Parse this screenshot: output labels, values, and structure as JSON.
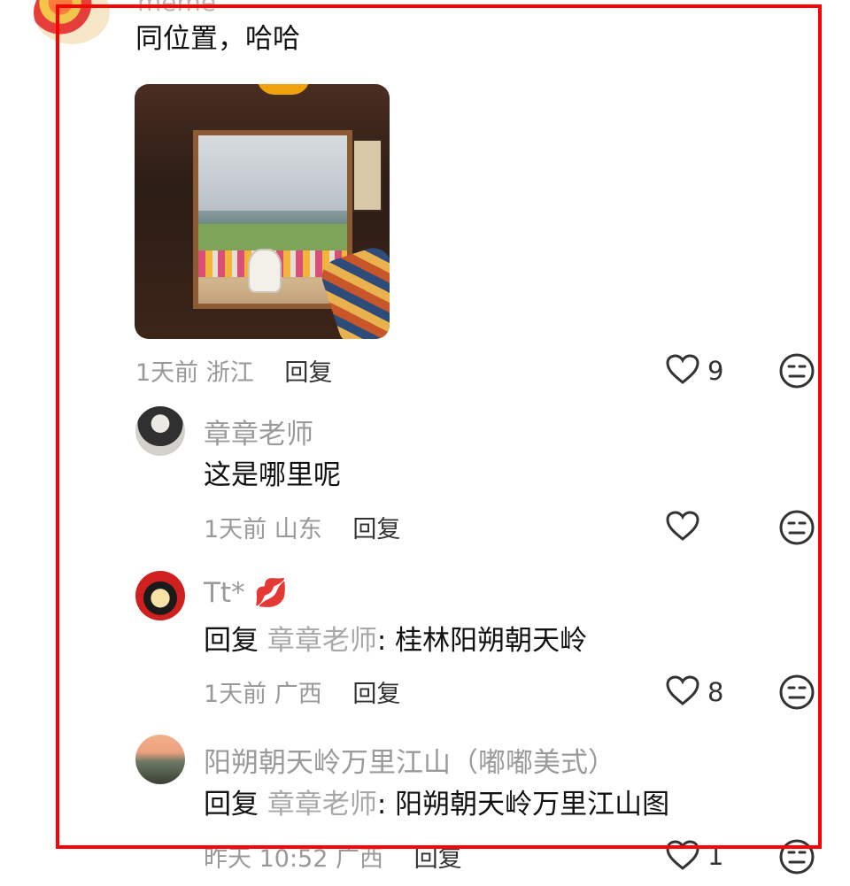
{
  "top": {
    "name": "meme",
    "comment": "同位置，哈哈",
    "time_location": "1天前 浙江",
    "reply_label": "回复",
    "like_count": "9"
  },
  "replies": [
    {
      "name": "章章老师",
      "text": "这是哪里呢",
      "time_location": "1天前 山东",
      "reply_label": "回复",
      "like_count": ""
    },
    {
      "name": "Tt*",
      "name_emoji": "💋",
      "prefix": "回复",
      "target": "章章老师",
      "text": ": 桂林阳朔朝天岭",
      "time_location": "1天前 广西",
      "reply_label": "回复",
      "like_count": "8"
    },
    {
      "name": "阳朔朝天岭万里江山（嘟嘟美式）",
      "prefix": "回复",
      "target": "章章老师",
      "text": ": 阳朔朝天岭万里江山图",
      "time_location": "昨天 10:52 广西",
      "reply_label": "回复",
      "like_count": "1"
    }
  ],
  "icons": {
    "like": "heart-outline-icon",
    "emoji": "neutral-face-icon"
  },
  "colors": {
    "highlight": "#ff0000",
    "muted": "#999999",
    "text": "#111111"
  }
}
